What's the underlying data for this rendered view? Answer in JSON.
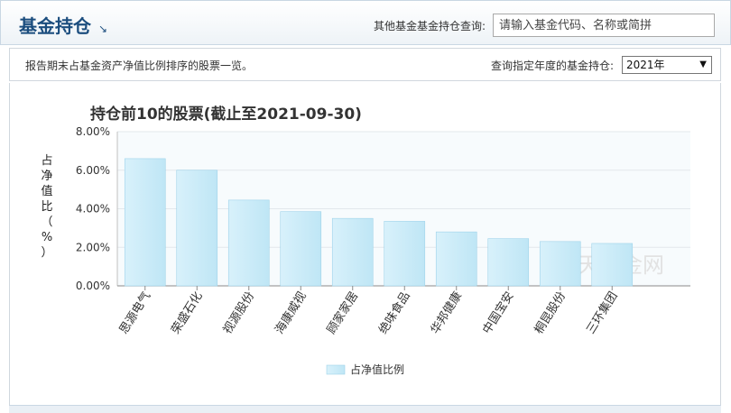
{
  "header": {
    "title": "基金持仓",
    "arrow_icon": "arrow-icon",
    "search_label": "其他基金基金持仓查询:",
    "search_placeholder": "请输入基金代码、名称或简拼"
  },
  "subbar": {
    "description": "报告期末占基金资产净值比例排序的股票一览。",
    "year_label": "查询指定年度的基金持仓:",
    "year_value": "2021年"
  },
  "watermark": "天天基金网",
  "colors": {
    "header_title": "#1b4d7e",
    "bar_fill": "#bfe6f5",
    "bar_stroke": "#9fd3ea",
    "plot_bg": "#f7fbfd"
  },
  "chart_data": {
    "type": "bar",
    "title": "持仓前10的股票(截止至2021-09-30)",
    "xlabel": "",
    "ylabel": "占净值比(%)",
    "ylabel_chars": [
      "占",
      "净",
      "值",
      "比",
      "（",
      "%",
      "）"
    ],
    "categories": [
      "思源电气",
      "荣盛石化",
      "视源股份",
      "海康威视",
      "顾家家居",
      "绝味食品",
      "华邦健康",
      "中国宝安",
      "桐昆股份",
      "三环集团"
    ],
    "series": [
      {
        "name": "占净值比例",
        "values": [
          6.6,
          6.0,
          4.45,
          3.85,
          3.5,
          3.35,
          2.8,
          2.45,
          2.3,
          2.2
        ]
      }
    ],
    "ylim": [
      0,
      8
    ],
    "yticks": [
      "0.00%",
      "2.00%",
      "4.00%",
      "6.00%",
      "8.00%"
    ],
    "ytick_values": [
      0,
      2,
      4,
      6,
      8
    ],
    "grid": true,
    "legend_position": "bottom-center"
  }
}
